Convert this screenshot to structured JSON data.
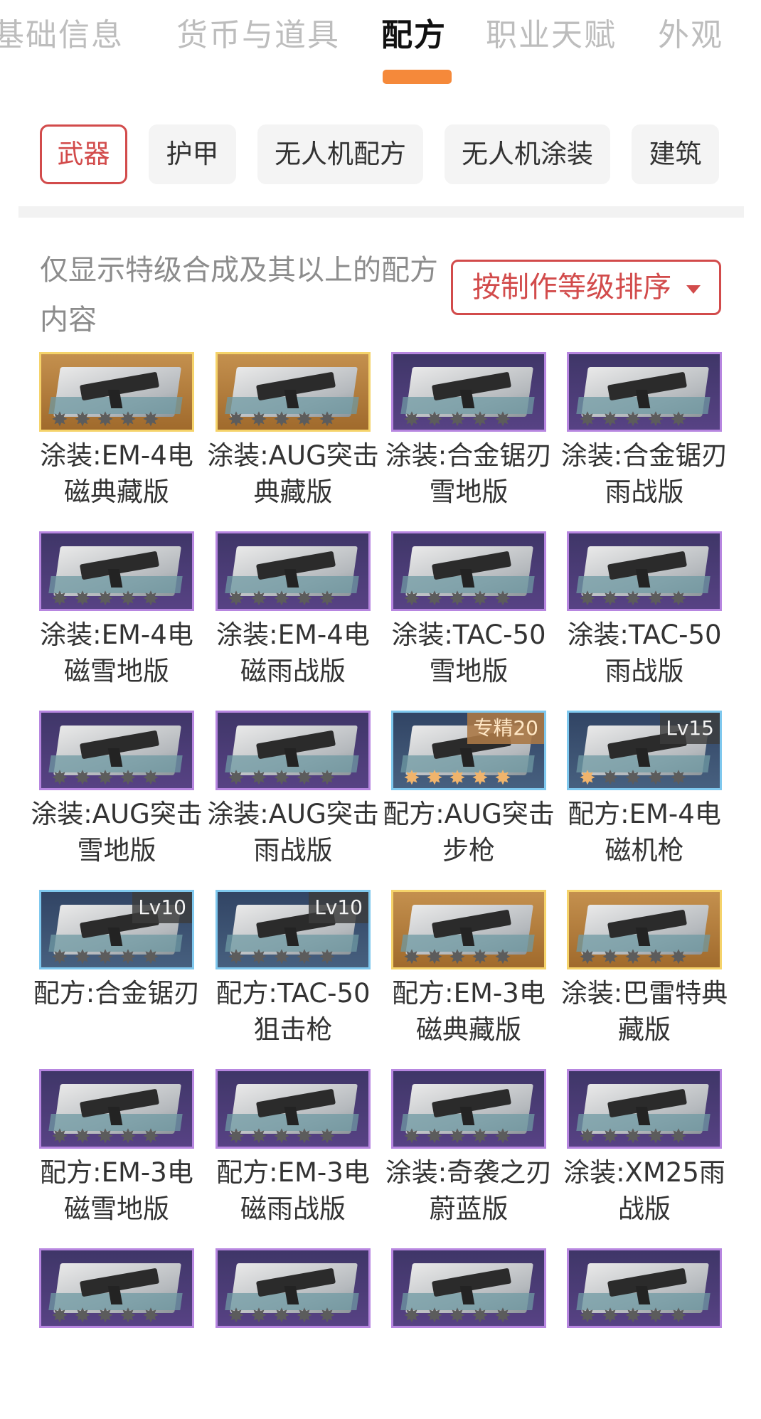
{
  "top_tabs": [
    {
      "label": "基础信息",
      "active": false
    },
    {
      "label": "货币与道具",
      "active": false
    },
    {
      "label": "配方",
      "active": true
    },
    {
      "label": "职业天赋",
      "active": false
    },
    {
      "label": "外观",
      "active": false
    }
  ],
  "colors": {
    "accent": "#d24b4b",
    "tab_indicator": "#f5893a"
  },
  "chips": [
    {
      "label": "武器",
      "active": true
    },
    {
      "label": "护甲",
      "active": false
    },
    {
      "label": "无人机配方",
      "active": false
    },
    {
      "label": "无人机涂装",
      "active": false
    },
    {
      "label": "建筑",
      "active": false
    }
  ],
  "filter_note": "仅显示特级合成及其以上的配方内容",
  "sort_button": "按制作等级排序",
  "sort_caret_icon": "caret-down-icon",
  "items": [
    {
      "name": "涂装:EM-4电磁典藏版",
      "rarity": "gold",
      "lit_stars": 0,
      "badge": ""
    },
    {
      "name": "涂装:AUG突击典藏版",
      "rarity": "gold",
      "lit_stars": 0,
      "badge": ""
    },
    {
      "name": "涂装:合金锯刃雪地版",
      "rarity": "purple",
      "lit_stars": 0,
      "badge": ""
    },
    {
      "name": "涂装:合金锯刃雨战版",
      "rarity": "purple",
      "lit_stars": 0,
      "badge": ""
    },
    {
      "name": "涂装:EM-4电磁雪地版",
      "rarity": "purple",
      "lit_stars": 0,
      "badge": ""
    },
    {
      "name": "涂装:EM-4电磁雨战版",
      "rarity": "purple",
      "lit_stars": 0,
      "badge": ""
    },
    {
      "name": "涂装:TAC-50雪地版",
      "rarity": "purple",
      "lit_stars": 0,
      "badge": ""
    },
    {
      "name": "涂装:TAC-50雨战版",
      "rarity": "purple",
      "lit_stars": 0,
      "badge": ""
    },
    {
      "name": "涂装:AUG突击雪地版",
      "rarity": "purple",
      "lit_stars": 0,
      "badge": ""
    },
    {
      "name": "涂装:AUG突击雨战版",
      "rarity": "purple",
      "lit_stars": 0,
      "badge": ""
    },
    {
      "name": "配方:AUG突击步枪",
      "rarity": "blue",
      "lit_stars": 5,
      "badge": "专精20"
    },
    {
      "name": "配方:EM-4电磁机枪",
      "rarity": "blue",
      "lit_stars": 1,
      "badge": "Lv15"
    },
    {
      "name": "配方:合金锯刃",
      "rarity": "blue",
      "lit_stars": 0,
      "badge": "Lv10"
    },
    {
      "name": "配方:TAC-50狙击枪",
      "rarity": "blue",
      "lit_stars": 0,
      "badge": "Lv10"
    },
    {
      "name": "配方:EM-3电磁典藏版",
      "rarity": "gold",
      "lit_stars": 0,
      "badge": ""
    },
    {
      "name": "涂装:巴雷特典藏版",
      "rarity": "gold",
      "lit_stars": 0,
      "badge": ""
    },
    {
      "name": "配方:EM-3电磁雪地版",
      "rarity": "purple",
      "lit_stars": 0,
      "badge": ""
    },
    {
      "name": "配方:EM-3电磁雨战版",
      "rarity": "purple",
      "lit_stars": 0,
      "badge": ""
    },
    {
      "name": "涂装:奇袭之刃蔚蓝版",
      "rarity": "purple",
      "lit_stars": 0,
      "badge": ""
    },
    {
      "name": "涂装:XM25雨战版",
      "rarity": "purple",
      "lit_stars": 0,
      "badge": ""
    },
    {
      "name": "",
      "rarity": "purple",
      "lit_stars": 0,
      "badge": ""
    },
    {
      "name": "",
      "rarity": "purple",
      "lit_stars": 0,
      "badge": ""
    },
    {
      "name": "",
      "rarity": "purple",
      "lit_stars": 0,
      "badge": ""
    },
    {
      "name": "",
      "rarity": "purple",
      "lit_stars": 0,
      "badge": ""
    }
  ]
}
